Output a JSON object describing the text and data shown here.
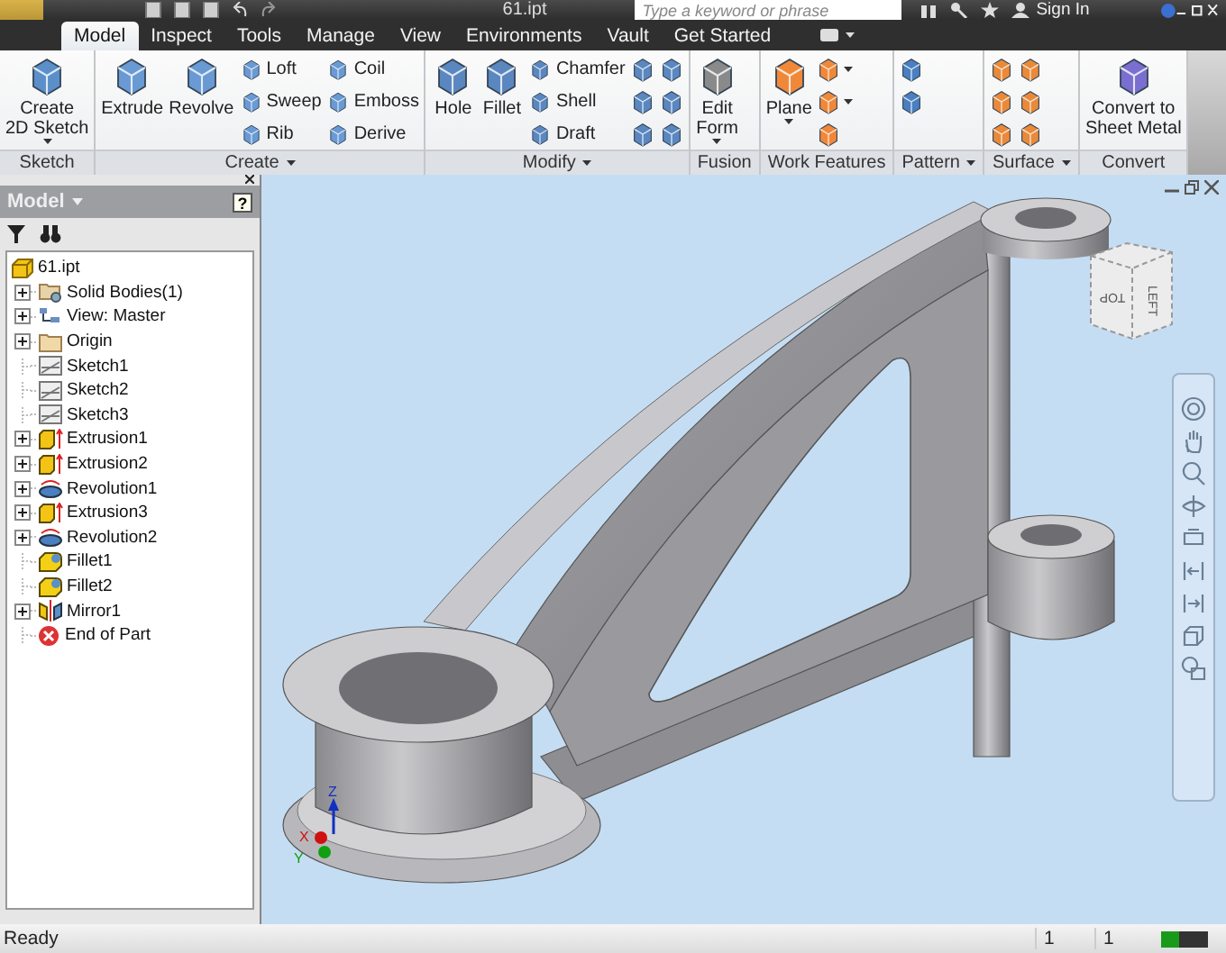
{
  "title_bar": {
    "file_name": "61.ipt",
    "search": {
      "placeholder": "Type a keyword or phrase"
    },
    "sign_in": "Sign In"
  },
  "tabs": [
    {
      "label": "Model",
      "selected": true
    },
    {
      "label": "Inspect",
      "selected": false
    },
    {
      "label": "Tools",
      "selected": false
    },
    {
      "label": "Manage",
      "selected": false
    },
    {
      "label": "View",
      "selected": false
    },
    {
      "label": "Environments",
      "selected": false
    },
    {
      "label": "Vault",
      "selected": false
    },
    {
      "label": "Get Started",
      "selected": false
    }
  ],
  "ribbon": {
    "panels": [
      {
        "title": "Sketch",
        "has_menu": false,
        "tools": [
          {
            "label": "Create\n2D Sketch",
            "kind": "large",
            "dropdown": true
          }
        ]
      },
      {
        "title": "Create",
        "has_menu": true,
        "tools": [
          {
            "label": "Extrude",
            "kind": "large",
            "dropdown": false
          },
          {
            "label": "Revolve",
            "kind": "large",
            "dropdown": false
          },
          {
            "label": "Loft",
            "kind": "small",
            "dropdown": false
          },
          {
            "label": "Sweep",
            "kind": "small",
            "dropdown": false
          },
          {
            "label": "Rib",
            "kind": "small",
            "dropdown": false
          },
          {
            "label": "Coil",
            "kind": "small",
            "dropdown": false
          },
          {
            "label": "Emboss",
            "kind": "small",
            "dropdown": false
          },
          {
            "label": "Derive",
            "kind": "small",
            "dropdown": false
          }
        ]
      },
      {
        "title": "Modify",
        "has_menu": true,
        "tools": [
          {
            "label": "Hole",
            "kind": "large",
            "dropdown": false
          },
          {
            "label": "Fillet",
            "kind": "large",
            "dropdown": false
          },
          {
            "label": "Chamfer",
            "kind": "small",
            "dropdown": false
          },
          {
            "label": "Shell",
            "kind": "small",
            "dropdown": false
          },
          {
            "label": "Draft",
            "kind": "small",
            "dropdown": false
          },
          {
            "kind": "icon",
            "dropdown": false
          },
          {
            "kind": "icon",
            "dropdown": false
          },
          {
            "kind": "icon",
            "dropdown": false
          },
          {
            "kind": "icon",
            "dropdown": false
          },
          {
            "kind": "icon",
            "dropdown": false
          },
          {
            "kind": "icon",
            "dropdown": false
          }
        ]
      },
      {
        "title": "Fusion",
        "has_menu": false,
        "tools": [
          {
            "label": "Edit\nForm",
            "kind": "large",
            "dropdown": true
          }
        ]
      },
      {
        "title": "Work Features",
        "has_menu": false,
        "tools": [
          {
            "label": "Plane",
            "kind": "large",
            "dropdown": true
          },
          {
            "kind": "icon",
            "dropdown": true
          },
          {
            "kind": "icon",
            "dropdown": true
          },
          {
            "kind": "icon",
            "dropdown": false
          }
        ]
      },
      {
        "title": "Pattern",
        "has_menu": true,
        "tools": [
          {
            "kind": "icon",
            "dropdown": false
          },
          {
            "kind": "icon",
            "dropdown": false
          }
        ]
      },
      {
        "title": "Surface",
        "has_menu": true,
        "tools": [
          {
            "kind": "icon",
            "dropdown": false
          },
          {
            "kind": "icon",
            "dropdown": false
          },
          {
            "kind": "icon",
            "dropdown": false
          },
          {
            "kind": "icon",
            "dropdown": false
          },
          {
            "kind": "icon",
            "dropdown": false
          },
          {
            "kind": "icon",
            "dropdown": false
          }
        ]
      },
      {
        "title": "Convert",
        "has_menu": false,
        "tools": [
          {
            "label": "Convert to\nSheet Metal",
            "kind": "large",
            "dropdown": false
          }
        ]
      }
    ]
  },
  "browser": {
    "title": "Model",
    "help": "?",
    "tree": [
      {
        "label": "61.ipt",
        "kind": "part",
        "children": [
          {
            "label": "Solid Bodies(1)",
            "kind": "bodies",
            "expandable": true,
            "expanded": false
          },
          {
            "label": "View: Master",
            "kind": "view",
            "expandable": true,
            "expanded": false
          },
          {
            "label": "Origin",
            "kind": "folder",
            "expandable": true,
            "expanded": false
          },
          {
            "label": "Sketch1",
            "kind": "sketch",
            "expandable": false
          },
          {
            "label": "Sketch2",
            "kind": "sketch",
            "expandable": false
          },
          {
            "label": "Sketch3",
            "kind": "sketch",
            "expandable": false
          },
          {
            "label": "Extrusion1",
            "kind": "extrusion",
            "expandable": true,
            "expanded": false
          },
          {
            "label": "Extrusion2",
            "kind": "extrusion",
            "expandable": true,
            "expanded": false
          },
          {
            "label": "Revolution1",
            "kind": "revolution",
            "expandable": true,
            "expanded": false
          },
          {
            "label": "Extrusion3",
            "kind": "extrusion",
            "expandable": true,
            "expanded": false
          },
          {
            "label": "Revolution2",
            "kind": "revolution",
            "expandable": true,
            "expanded": false
          },
          {
            "label": "Fillet1",
            "kind": "fillet",
            "expandable": false
          },
          {
            "label": "Fillet2",
            "kind": "fillet",
            "expandable": false
          },
          {
            "label": "Mirror1",
            "kind": "mirror",
            "expandable": true,
            "expanded": false
          },
          {
            "label": "End of Part",
            "kind": "end",
            "expandable": false
          }
        ]
      }
    ]
  },
  "viewport": {
    "view_cube": {
      "faces": [
        "TOP",
        "LEFT"
      ]
    },
    "axes": [
      "Z",
      "X",
      "Y"
    ]
  },
  "status_bar": {
    "message": "Ready",
    "fields": [
      "1",
      "1"
    ],
    "memory": {
      "level": 0.4
    }
  }
}
